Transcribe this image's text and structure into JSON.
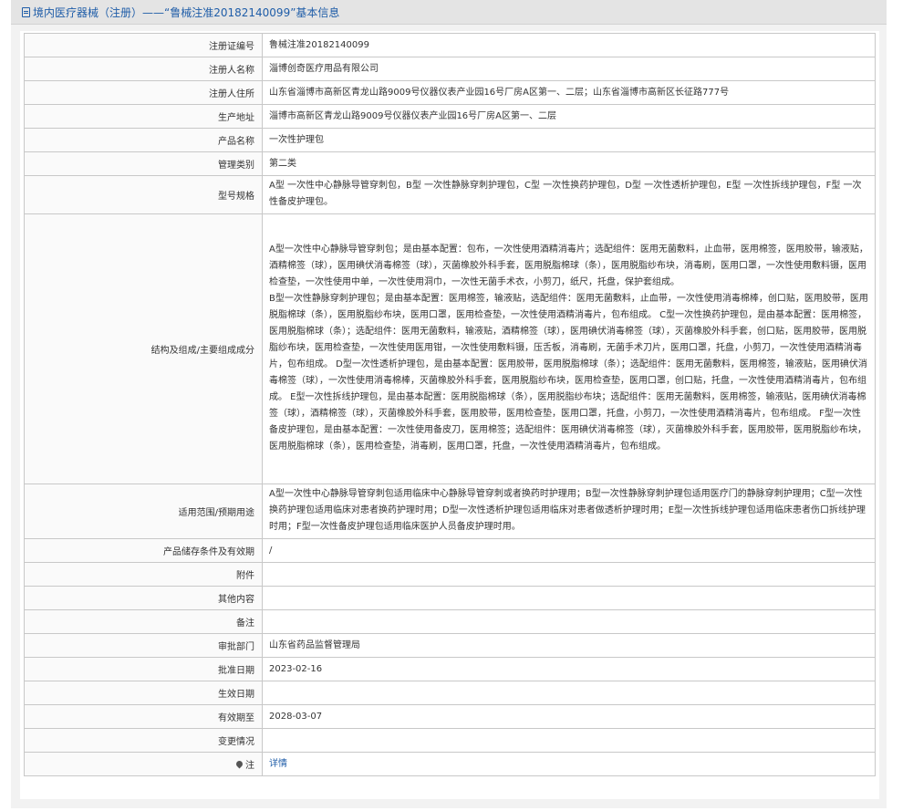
{
  "header": {
    "title": "境内医疗器械（注册）——“鲁械注准20182140099”基本信息",
    "icon": "document-icon"
  },
  "rows": [
    {
      "label": "注册证编号",
      "value": "鲁械注准20182140099"
    },
    {
      "label": "注册人名称",
      "value": "淄博创奇医疗用品有限公司"
    },
    {
      "label": "注册人住所",
      "value": "山东省淄博市高新区青龙山路9009号仪器仪表产业园16号厂房A区第一、二层；山东省淄博市高新区长征路777号"
    },
    {
      "label": "生产地址",
      "value": "淄博市高新区青龙山路9009号仪器仪表产业园16号厂房A区第一、二层"
    },
    {
      "label": "产品名称",
      "value": "一次性护理包"
    },
    {
      "label": "管理类别",
      "value": "第二类"
    },
    {
      "label": "型号规格",
      "value": "A型 一次性中心静脉导管穿刺包，B型 一次性静脉穿刺护理包，C型 一次性换药护理包，D型 一次性透析护理包，E型 一次性拆线护理包，F型 一次性备皮护理包。"
    },
    {
      "label": "结构及组成/主要组成成分",
      "value": "A型一次性中心静脉导管穿刺包；是由基本配置：包布，一次性使用酒精消毒片；选配组件：医用无菌敷料，止血带，医用棉签，医用胶带，输液贴，酒精棉签（球），医用碘伏消毒棉签（球），灭菌橡胶外科手套，医用脱脂棉球（条），医用脱脂纱布块，消毒刷，医用口罩，一次性使用敷料镊，医用检查垫，一次性使用中单，一次性使用洞巾，一次性无菌手术衣，小剪刀，纸尺，托盘，保护套组成。\nB型一次性静脉穿刺护理包；是由基本配置：医用棉签，输液贴，选配组件：医用无菌敷料，止血带，一次性使用消毒棉棒，创口贴，医用胶带，医用脱脂棉球（条），医用脱脂纱布块，医用口罩，医用检查垫，一次性使用酒精消毒片，包布组成。 C型一次性换药护理包，是由基本配置：医用棉签，医用脱脂棉球（条）；选配组件：医用无菌敷料，输液贴，酒精棉签（球），医用碘伏消毒棉签（球），灭菌橡胶外科手套，创口贴，医用胶带，医用脱脂纱布块，医用检查垫，一次性使用医用钳，一次性使用敷料镊，压舌板，消毒刷，无菌手术刀片，医用口罩，托盘，小剪刀，一次性使用酒精消毒片，包布组成。 D型一次性透析护理包，是由基本配置：医用胶带，医用脱脂棉球（条）；选配组件：医用无菌敷料，医用棉签，输液贴，医用碘伏消毒棉签（球），一次性使用消毒棉棒，灭菌橡胶外科手套，医用脱脂纱布块，医用检查垫，医用口罩，创口贴，托盘，一次性使用酒精消毒片，包布组成。 E型一次性拆线护理包，是由基本配置：医用脱脂棉球（条），医用脱脂纱布块；选配组件：医用无菌敷料，医用棉签，输液贴，医用碘伏消毒棉签（球），酒精棉签（球），灭菌橡胶外科手套，医用胶带，医用检查垫，医用口罩，托盘，小剪刀，一次性使用酒精消毒片，包布组成。 F型一次性备皮护理包，是由基本配置：一次性使用备皮刀，医用棉签；选配组件：医用碘伏消毒棉签（球），灭菌橡胶外科手套，医用胶带，医用脱脂纱布块，医用脱脂棉球（条），医用检查垫，消毒刷，医用口罩，托盘，一次性使用酒精消毒片，包布组成。"
    },
    {
      "label": "适用范围/预期用途",
      "value": "A型一次性中心静脉导管穿刺包适用临床中心静脉导管穿刺或者换药时护理用；B型一次性静脉穿刺护理包适用医疗门的静脉穿刺护理用；C型一次性换药护理包适用临床对患者换药护理时用；D型一次性透析护理包适用临床对患者做透析护理时用；E型一次性拆线护理包适用临床患者伤口拆线护理时用；F型一次性备皮护理包适用临床医护人员备皮护理时用。"
    },
    {
      "label": "产品储存条件及有效期",
      "value": "/"
    },
    {
      "label": "附件",
      "value": ""
    },
    {
      "label": "其他内容",
      "value": ""
    },
    {
      "label": "备注",
      "value": ""
    },
    {
      "label": "审批部门",
      "value": "山东省药品监督管理局"
    },
    {
      "label": "批准日期",
      "value": "2023-02-16"
    },
    {
      "label": "生效日期",
      "value": ""
    },
    {
      "label": "有效期至",
      "value": "2028-03-07"
    },
    {
      "label": "变更情况",
      "value": ""
    }
  ],
  "note_row": {
    "label": "注",
    "link_text": "详情",
    "icon": "pin-icon"
  },
  "colors": {
    "title": "#1f5da8",
    "border": "#c8c8c8",
    "link": "#1f5da8"
  }
}
